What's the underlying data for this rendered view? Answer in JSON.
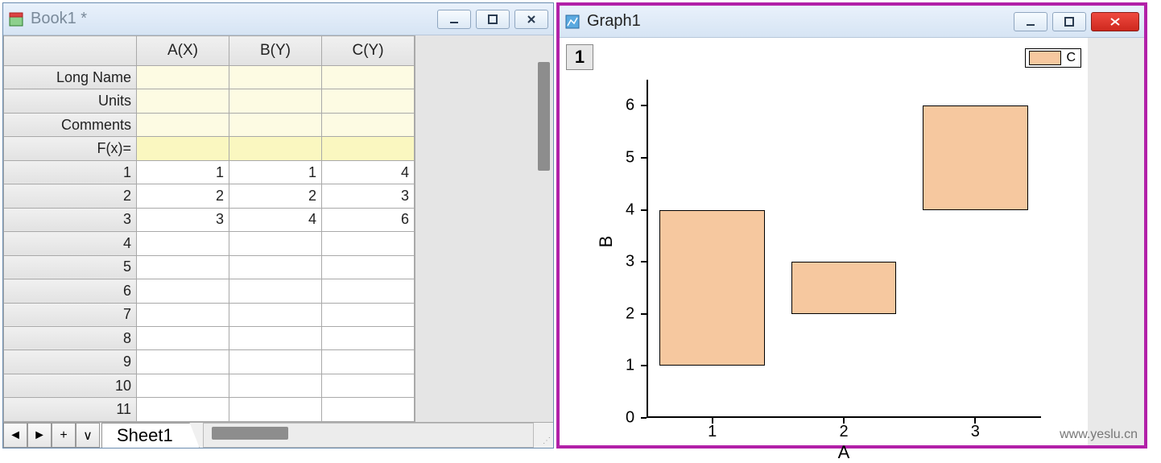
{
  "book": {
    "title": "Book1 *",
    "columns": [
      "A(X)",
      "B(Y)",
      "C(Y)"
    ],
    "meta_rows": [
      "Long Name",
      "Units",
      "Comments",
      "F(x)="
    ],
    "data": [
      {
        "n": "1",
        "a": "1",
        "b": "1",
        "c": "4"
      },
      {
        "n": "2",
        "a": "2",
        "b": "2",
        "c": "3"
      },
      {
        "n": "3",
        "a": "3",
        "b": "4",
        "c": "6"
      },
      {
        "n": "4",
        "a": "",
        "b": "",
        "c": ""
      },
      {
        "n": "5",
        "a": "",
        "b": "",
        "c": ""
      },
      {
        "n": "6",
        "a": "",
        "b": "",
        "c": ""
      },
      {
        "n": "7",
        "a": "",
        "b": "",
        "c": ""
      },
      {
        "n": "8",
        "a": "",
        "b": "",
        "c": ""
      },
      {
        "n": "9",
        "a": "",
        "b": "",
        "c": ""
      },
      {
        "n": "10",
        "a": "",
        "b": "",
        "c": ""
      },
      {
        "n": "11",
        "a": "",
        "b": "",
        "c": ""
      }
    ],
    "sheet_tab": "Sheet1",
    "nav": {
      "prev": "◄",
      "next": "►",
      "add": "+",
      "expand": "∨"
    }
  },
  "graph": {
    "title": "Graph1",
    "layer_badge": "1",
    "legend_label": "C",
    "xlabel": "A",
    "ylabel": "B",
    "x_ticks": [
      "1",
      "2",
      "3"
    ],
    "y_ticks": [
      "0",
      "1",
      "2",
      "3",
      "4",
      "5",
      "6"
    ]
  },
  "watermark": "www.yeslu.cn",
  "chart_data": {
    "type": "bar",
    "xlabel": "A",
    "ylabel": "B",
    "x_range": [
      0.5,
      3.5
    ],
    "y_range": [
      0,
      6.5
    ],
    "x_ticks": [
      1,
      2,
      3
    ],
    "y_ticks": [
      0,
      1,
      2,
      3,
      4,
      5,
      6
    ],
    "series": [
      {
        "name": "C",
        "bars": [
          {
            "x": 1,
            "y_low": 1,
            "y_high": 4
          },
          {
            "x": 2,
            "y_low": 2,
            "y_high": 3
          },
          {
            "x": 3,
            "y_low": 4,
            "y_high": 6
          }
        ]
      }
    ],
    "bar_width": 0.8,
    "fill": "#f6c89f",
    "legend_position": "top-right"
  }
}
